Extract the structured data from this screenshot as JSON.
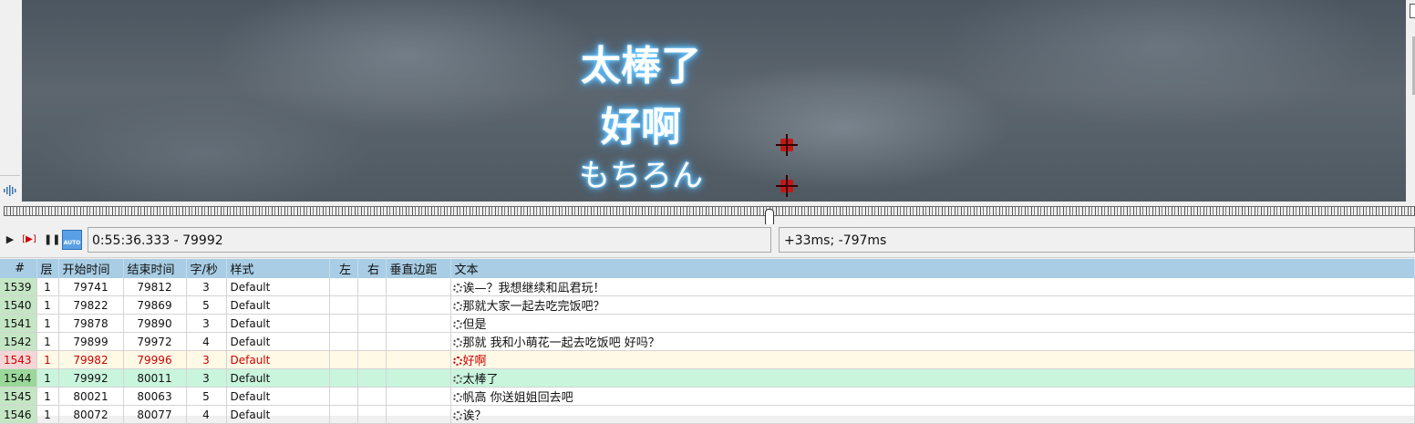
{
  "video": {
    "subtitle_lines": [
      "太棒了",
      "好啊",
      "もちろん"
    ]
  },
  "controls": {
    "time_display": "0:55:36.333 - 79992",
    "offset_display": "+33ms; -797ms",
    "auto_label": "AUTO"
  },
  "grid": {
    "headers": [
      "#",
      "层",
      "开始时间",
      "结束时间",
      "字/秒",
      "样式",
      "左",
      "右",
      "垂直边距",
      "文本"
    ],
    "rows": [
      {
        "num": "1539",
        "layer": "1",
        "start": "79741",
        "end": "79812",
        "cps": "3",
        "style": "Default",
        "left": "",
        "right": "",
        "vert": "",
        "text": "诶—？我想继续和凪君玩！"
      },
      {
        "num": "1540",
        "layer": "1",
        "start": "79822",
        "end": "79869",
        "cps": "5",
        "style": "Default",
        "left": "",
        "right": "",
        "vert": "",
        "text": "那就大家一起去吃完饭吧？"
      },
      {
        "num": "1541",
        "layer": "1",
        "start": "79878",
        "end": "79890",
        "cps": "3",
        "style": "Default",
        "left": "",
        "right": "",
        "vert": "",
        "text": "但是"
      },
      {
        "num": "1542",
        "layer": "1",
        "start": "79899",
        "end": "79972",
        "cps": "4",
        "style": "Default",
        "left": "",
        "right": "",
        "vert": "",
        "text": "那就 我和小萌花一起去吃饭吧 好吗？"
      },
      {
        "num": "1543",
        "layer": "1",
        "start": "79982",
        "end": "79996",
        "cps": "3",
        "style": "Default",
        "left": "",
        "right": "",
        "vert": "",
        "text": "好啊"
      },
      {
        "num": "1544",
        "layer": "1",
        "start": "79992",
        "end": "80011",
        "cps": "3",
        "style": "Default",
        "left": "",
        "right": "",
        "vert": "",
        "text": "太棒了"
      },
      {
        "num": "1545",
        "layer": "1",
        "start": "80021",
        "end": "80063",
        "cps": "5",
        "style": "Default",
        "left": "",
        "right": "",
        "vert": "",
        "text": "帆高 你送姐姐回去吧"
      },
      {
        "num": "1546",
        "layer": "1",
        "start": "80072",
        "end": "80077",
        "cps": "4",
        "style": "Default",
        "left": "",
        "right": "",
        "vert": "",
        "text": "诶？"
      }
    ]
  }
}
